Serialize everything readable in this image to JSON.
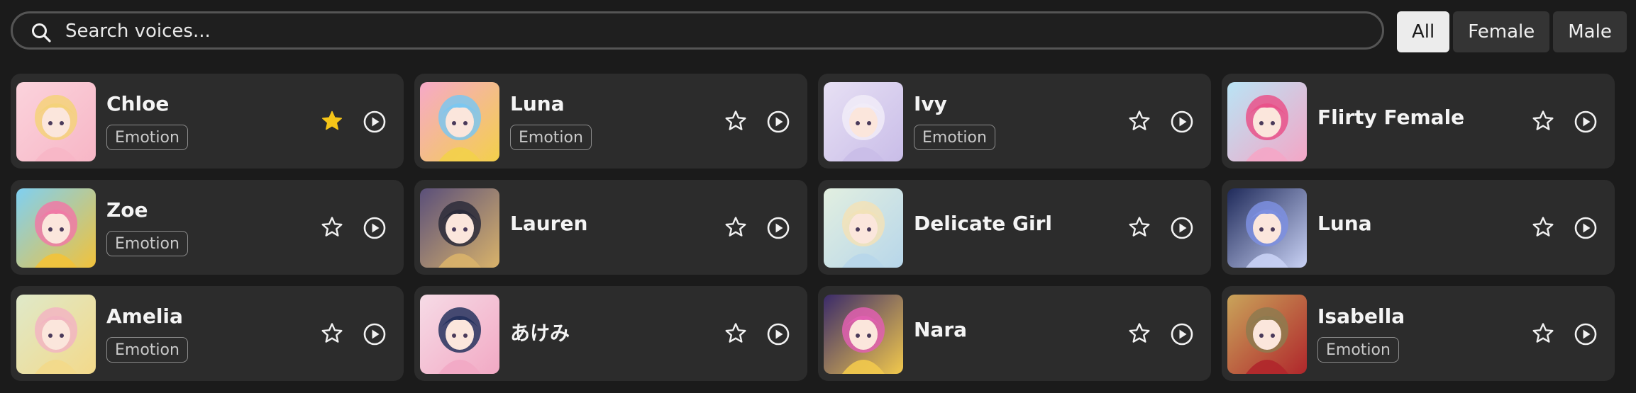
{
  "search": {
    "placeholder": "Search voices..."
  },
  "filters": [
    {
      "label": "All",
      "active": true
    },
    {
      "label": "Female",
      "active": false
    },
    {
      "label": "Male",
      "active": false
    }
  ],
  "colors": {
    "star_filled": "#f5c518",
    "card_bg": "#2c2c2c",
    "page_bg": "#1b1b1b"
  },
  "voices": [
    {
      "name": "Chloe",
      "tag": "Emotion",
      "favorited": true,
      "avatar_palette": [
        "#fbd3dc",
        "#f7b6c6",
        "#f4d27a"
      ]
    },
    {
      "name": "Luna",
      "tag": "Emotion",
      "favorited": false,
      "avatar_palette": [
        "#f6a9c9",
        "#f3d04a",
        "#7cc7f0"
      ]
    },
    {
      "name": "Ivy",
      "tag": "Emotion",
      "favorited": false,
      "avatar_palette": [
        "#e7e0f4",
        "#c9bde8",
        "#f1ecf8"
      ]
    },
    {
      "name": "Flirty Female",
      "tag": "",
      "favorited": false,
      "avatar_palette": [
        "#b9e4f5",
        "#f4a6c6",
        "#e9528a"
      ]
    },
    {
      "name": "Zoe",
      "tag": "Emotion",
      "favorited": false,
      "avatar_palette": [
        "#7fd0f2",
        "#f2c23a",
        "#f07aa6"
      ]
    },
    {
      "name": "Lauren",
      "tag": "",
      "favorited": false,
      "avatar_palette": [
        "#5a4f7a",
        "#d9b36a",
        "#2b2b3a"
      ]
    },
    {
      "name": "Delicate Girl",
      "tag": "",
      "favorited": false,
      "avatar_palette": [
        "#e2efe0",
        "#b7d6ea",
        "#f2e2b8"
      ]
    },
    {
      "name": "Luna",
      "tag": "",
      "favorited": false,
      "avatar_palette": [
        "#1f2a5a",
        "#c9d2f5",
        "#7d8fe0"
      ]
    },
    {
      "name": "Amelia",
      "tag": "Emotion",
      "favorited": false,
      "avatar_palette": [
        "#dfe9c9",
        "#f3d98a",
        "#f2b5c2"
      ]
    },
    {
      "name": "あけみ",
      "tag": "",
      "favorited": false,
      "avatar_palette": [
        "#f6dbe6",
        "#f2a9c4",
        "#26325e"
      ]
    },
    {
      "name": "Nara",
      "tag": "",
      "favorited": false,
      "avatar_palette": [
        "#3a2a6a",
        "#f2c94c",
        "#e05fb0"
      ]
    },
    {
      "name": "Isabella",
      "tag": "Emotion",
      "favorited": false,
      "avatar_palette": [
        "#c9a45a",
        "#b0262b",
        "#8e7a4f"
      ]
    }
  ]
}
